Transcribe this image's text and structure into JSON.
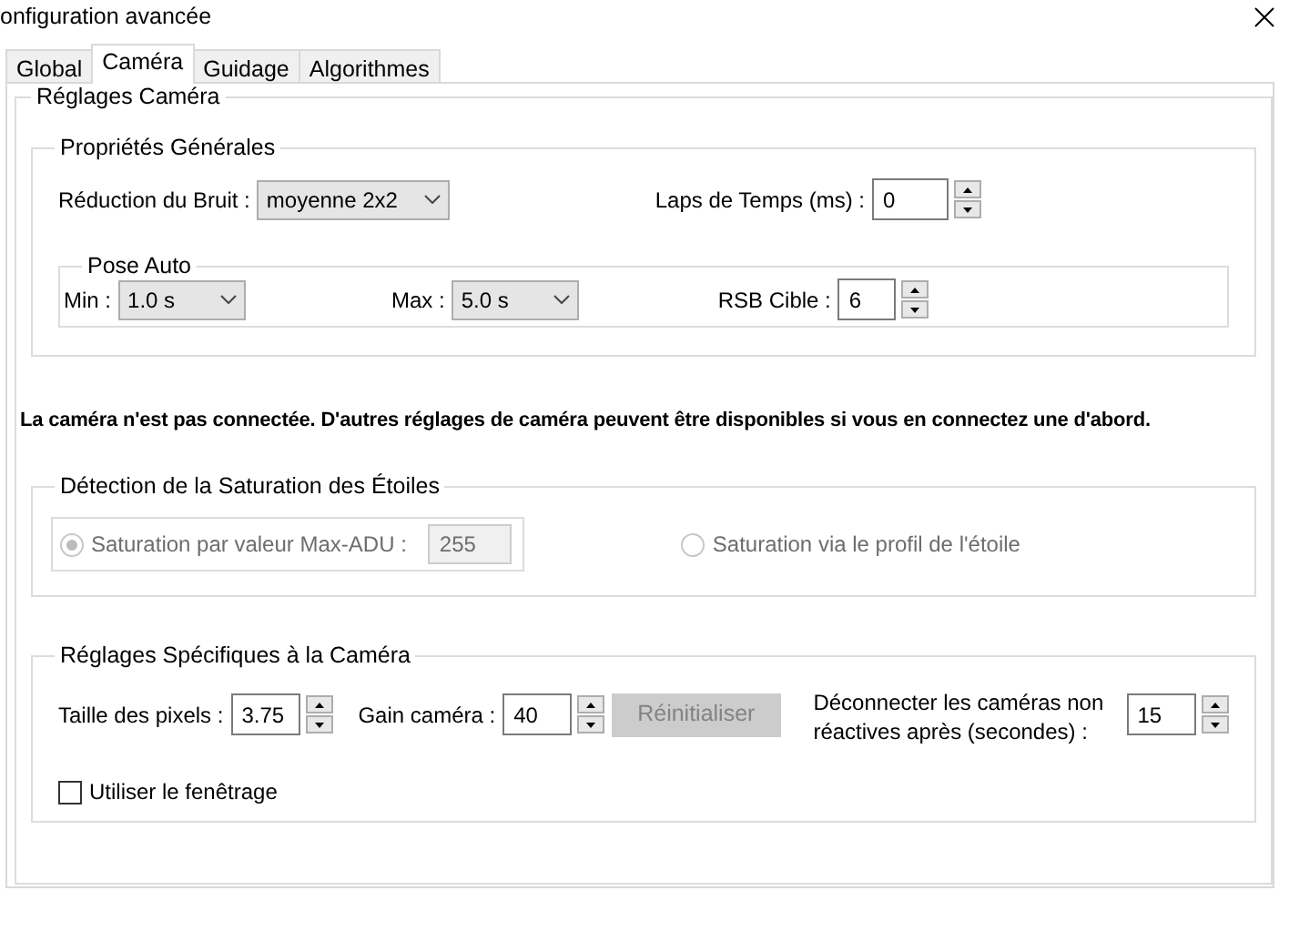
{
  "window": {
    "title": "onfiguration avancée"
  },
  "tabs": [
    {
      "label": "Global",
      "selected": false
    },
    {
      "label": "Caméra",
      "selected": true
    },
    {
      "label": "Guidage",
      "selected": false
    },
    {
      "label": "Algorithmes",
      "selected": false
    }
  ],
  "camera_settings": {
    "title": "Réglages Caméra",
    "general": {
      "title": "Propriétés Générales",
      "noise_reduction": {
        "label": "Réduction du Bruit :",
        "value": "moyenne 2x2"
      },
      "time_lapse": {
        "label": "Laps de Temps (ms) :",
        "value": "0"
      },
      "auto_exposure": {
        "title": "Pose Auto",
        "min": {
          "label": "Min :",
          "value": "1.0 s"
        },
        "max": {
          "label": "Max :",
          "value": "5.0 s"
        },
        "target_snr": {
          "label": "RSB Cible :",
          "value": "6"
        }
      }
    },
    "notice": "La caméra n'est pas connectée. D'autres réglages de caméra peuvent être disponibles si vous en connectez une d'abord.",
    "saturation": {
      "title": "Détection de la Saturation des Étoiles",
      "disabled": true,
      "options": [
        {
          "label": "Saturation par valeur Max-ADU :",
          "selected": true,
          "value": "255"
        },
        {
          "label": "Saturation via le profil de l'étoile",
          "selected": false
        }
      ]
    },
    "camera_specific": {
      "title": "Réglages Spécifiques à la Caméra",
      "pixel_size": {
        "label": "Taille des pixels :",
        "value": "3.75"
      },
      "gain": {
        "label": "Gain caméra :",
        "value": "40"
      },
      "reset_button": {
        "label": "Réinitialiser",
        "disabled": true
      },
      "disconnect": {
        "label": "Déconnecter les caméras non réactives après (secondes) :",
        "value": "15"
      },
      "windowing": {
        "label": "Utiliser le fenêtrage",
        "checked": false
      }
    }
  }
}
